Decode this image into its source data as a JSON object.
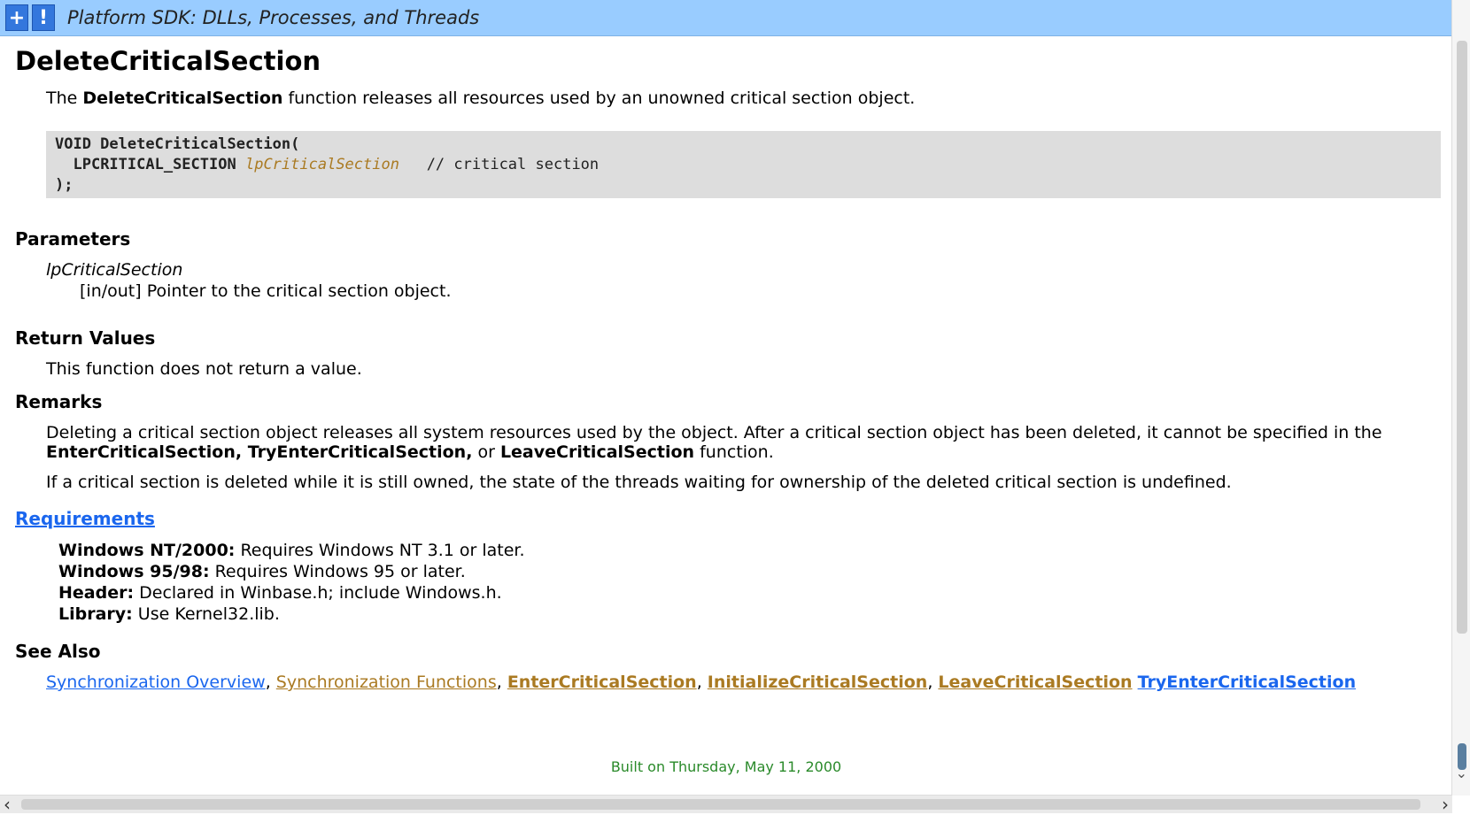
{
  "banner": {
    "expand_label": "+",
    "alert_label": "!",
    "title": "Platform SDK: DLLs, Processes, and Threads"
  },
  "page": {
    "title": "DeleteCriticalSection",
    "intro_pre": "The ",
    "intro_bold": "DeleteCriticalSection",
    "intro_post": " function releases all resources used by an unowned critical section object."
  },
  "code": {
    "line1": "VOID DeleteCriticalSection(",
    "line2_type": "LPCRITICAL_SECTION",
    "line2_param": "lpCriticalSection",
    "line2_comment": "// critical section",
    "line3": ");"
  },
  "parameters": {
    "heading": "Parameters",
    "name": "lpCriticalSection",
    "desc": "[in/out] Pointer to the critical section object."
  },
  "return_values": {
    "heading": "Return Values",
    "text": "This function does not return a value."
  },
  "remarks": {
    "heading": "Remarks",
    "p1_a": "Deleting a critical section object releases all system resources used by the object. After a critical section object has been deleted, it cannot be specified in the",
    "p1_b1": "EnterCriticalSection, TryEnterCriticalSection,",
    "p1_b2": " or ",
    "p1_b3": "LeaveCriticalSection",
    "p1_b4": " function.",
    "p2": "If a critical section is deleted while it is still owned, the state of the threads waiting for ownership of the deleted critical section is undefined."
  },
  "requirements": {
    "heading": "Requirements",
    "rows": [
      {
        "label": "Windows NT/2000:",
        "value": " Requires Windows NT 3.1 or later."
      },
      {
        "label": "Windows 95/98:",
        "value": " Requires Windows 95 or later."
      },
      {
        "label": "Header:",
        "value": " Declared in Winbase.h; include Windows.h."
      },
      {
        "label": "Library:",
        "value": " Use Kernel32.lib."
      }
    ]
  },
  "see_also": {
    "heading": "See Also",
    "links": [
      "Synchronization Overview",
      "Synchronization Functions",
      "EnterCriticalSection",
      "InitializeCriticalSection",
      "LeaveCriticalSection",
      "TryEnterCriticalSection"
    ],
    "sep": ", "
  },
  "footer": "Built on Thursday, May 11, 2000",
  "colors": {
    "banner": "#99ccff",
    "link_blue": "#1a66ee",
    "link_brown": "#aa7a22",
    "footer_green": "#2a8a2a"
  }
}
